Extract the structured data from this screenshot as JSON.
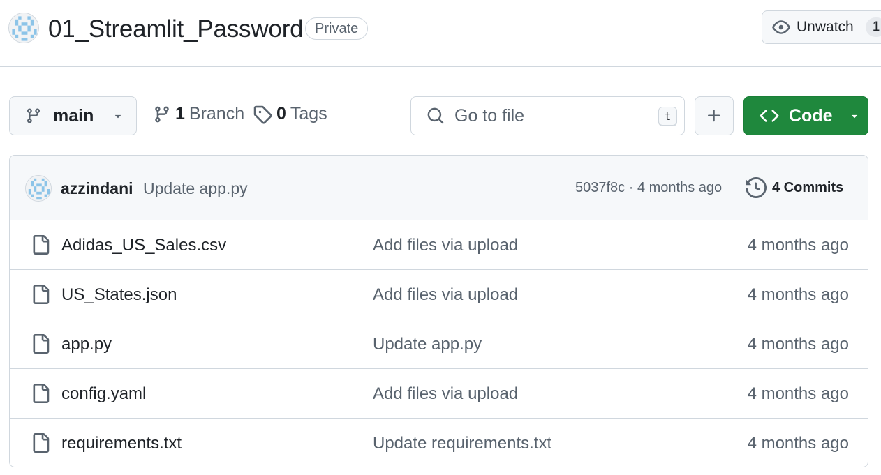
{
  "repo": {
    "name": "01_Streamlit_Password",
    "visibility": "Private"
  },
  "watch": {
    "label": "Unwatch",
    "count": "1"
  },
  "toolbar": {
    "branch": "main",
    "branches_count": "1",
    "branches_label": "Branch",
    "tags_count": "0",
    "tags_label": "Tags",
    "search_placeholder": "Go to file",
    "search_shortcut": "t",
    "code_label": "Code"
  },
  "latest_commit": {
    "author": "azzindani",
    "message": "Update app.py",
    "meta": "5037f8c · 4 months ago",
    "commits_label": "4 Commits"
  },
  "files": [
    {
      "name": "Adidas_US_Sales.csv",
      "message": "Add files via upload",
      "date": "4 months ago"
    },
    {
      "name": "US_States.json",
      "message": "Add files via upload",
      "date": "4 months ago"
    },
    {
      "name": "app.py",
      "message": "Update app.py",
      "date": "4 months ago"
    },
    {
      "name": "config.yaml",
      "message": "Add files via upload",
      "date": "4 months ago"
    },
    {
      "name": "requirements.txt",
      "message": "Update requirements.txt",
      "date": "4 months ago"
    }
  ],
  "colors": {
    "code_button": "#1f883d",
    "border": "#d0d7de",
    "muted_text": "#59636e",
    "avatar_pattern": "#8cc4e8"
  },
  "icons": [
    "identicon-avatar",
    "eye-icon",
    "git-branch-icon",
    "tag-icon",
    "search-icon",
    "plus-icon",
    "code-icon",
    "triangle-down-icon",
    "history-icon",
    "file-icon"
  ]
}
